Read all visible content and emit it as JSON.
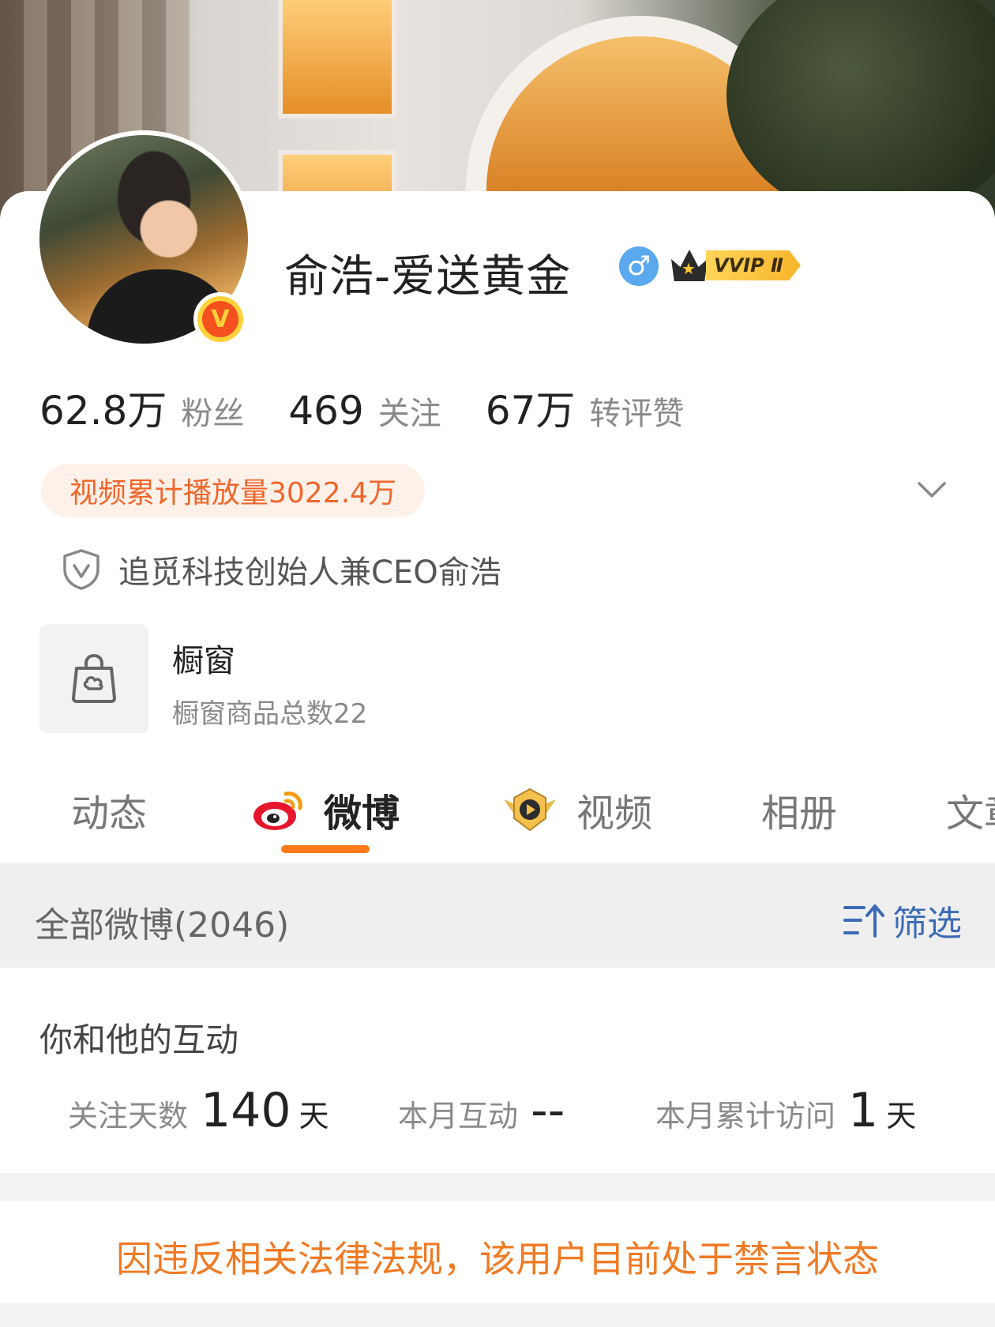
{
  "profile": {
    "name": "俞浩-爱送黄金",
    "gender_symbol": "♂",
    "verified_letter": "V",
    "vip_label": "VVIP Ⅱ",
    "accent_color": "#f0662a",
    "gender_color": "#5aa8ee"
  },
  "stats": [
    {
      "value": "62.8万",
      "label": "粉丝"
    },
    {
      "value": "469",
      "label": "关注"
    },
    {
      "value": "67万",
      "label": "转评赞"
    }
  ],
  "video_pill": "视频累计播放量3022.4万",
  "verification": {
    "icon": "shield-v-icon",
    "text": "追觅科技创始人兼CEO俞浩"
  },
  "shop": {
    "icon": "shopping-bag-icon",
    "title": "橱窗",
    "subtitle": "橱窗商品总数22"
  },
  "tabs": [
    {
      "label": "动态",
      "active": false
    },
    {
      "label": "微博",
      "active": true,
      "icon": "weibo-logo-icon"
    },
    {
      "label": "视频",
      "active": false,
      "icon": "video-badge-icon"
    },
    {
      "label": "相册",
      "active": false
    },
    {
      "label": "文章",
      "active": false
    }
  ],
  "all_weibo": {
    "title": "全部微博(2046)",
    "filter_label": "筛选",
    "filter_icon": "filter-sort-icon"
  },
  "interaction": {
    "title": "你和他的互动",
    "metrics": [
      {
        "label": "关注天数",
        "value": "140",
        "unit": "天"
      },
      {
        "label": "本月互动",
        "value": "--",
        "unit": ""
      },
      {
        "label": "本月累计访问",
        "value": "1",
        "unit": "天"
      }
    ]
  },
  "ban_notice": "因违反相关法律法规，该用户目前处于禁言状态"
}
